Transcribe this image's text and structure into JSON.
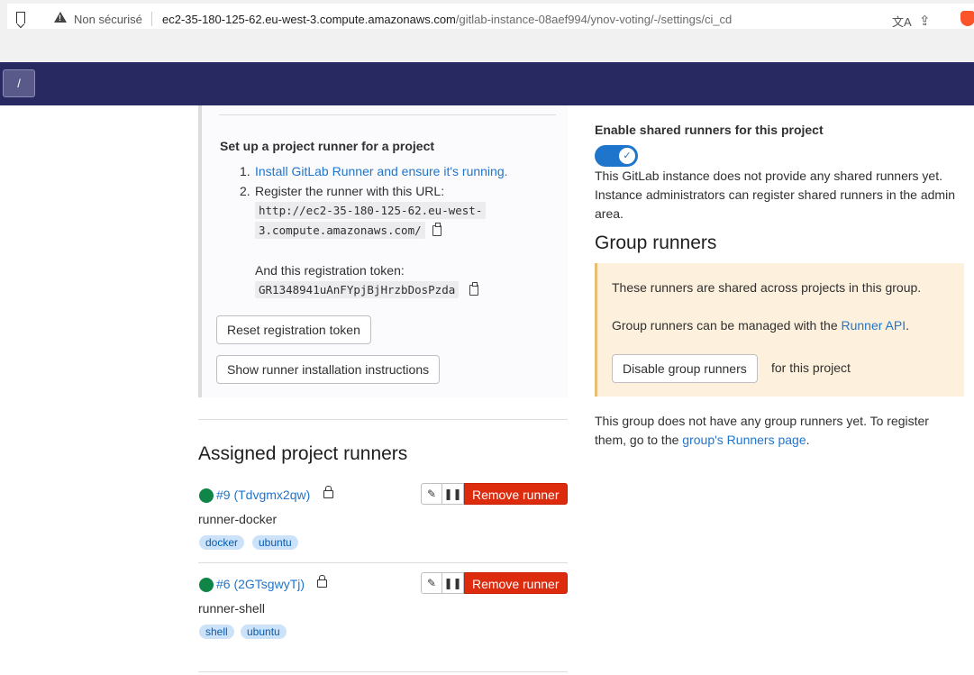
{
  "browser": {
    "insecure_label": "Non sécurisé",
    "url_host": "ec2-35-180-125-62.eu-west-3.compute.amazonaws.com",
    "url_path": "/gitlab-instance-08aef994/ynov-voting/-/settings/ci_cd"
  },
  "navbar": {
    "slash_label": "/"
  },
  "setup": {
    "title": "Set up a project runner for a project",
    "step1_num": "1.",
    "step1_link": "Install GitLab Runner and ensure it's running.",
    "step2_num": "2.",
    "step2_text": "Register the runner with this URL:",
    "url_line1": "http://ec2-35-180-125-62.eu-west-",
    "url_line2": "3.compute.amazonaws.com/",
    "token_label": "And this registration token:",
    "token": "GR1348941uAnFYpjBjHrzbDosPzda",
    "reset_button": "Reset registration token",
    "show_button": "Show runner installation instructions"
  },
  "assigned": {
    "title": "Assigned project runners",
    "runners": [
      {
        "id_label": "#9 (Tdvgmx2qw)",
        "description": "runner-docker",
        "tags": [
          "docker",
          "ubuntu"
        ],
        "remove_label": "Remove runner"
      },
      {
        "id_label": "#6 (2GTsgwyTj)",
        "description": "runner-shell",
        "tags": [
          "shell",
          "ubuntu"
        ],
        "remove_label": "Remove runner"
      }
    ]
  },
  "shared": {
    "title": "Enable shared runners for this project",
    "enabled": true,
    "description": "This GitLab instance does not provide any shared runners yet. Instance administrators can register shared runners in the admin area."
  },
  "group": {
    "title": "Group runners",
    "alert_line1": "These runners are shared across projects in this group.",
    "alert_line2_prefix": "Group runners can be managed with the",
    "alert_link": "Runner API",
    "alert_line2_suffix": ".",
    "disable_button": "Disable group runners",
    "disable_suffix": "for this project",
    "none_prefix": "This group does not have any group runners yet. To register them, go to the",
    "none_link": "group's Runners page",
    "none_suffix": "."
  },
  "colors": {
    "nav": "#292961",
    "link": "#1f75cb",
    "danger": "#dd2b0e",
    "success": "#108548",
    "toggle": "#1f75cb"
  }
}
